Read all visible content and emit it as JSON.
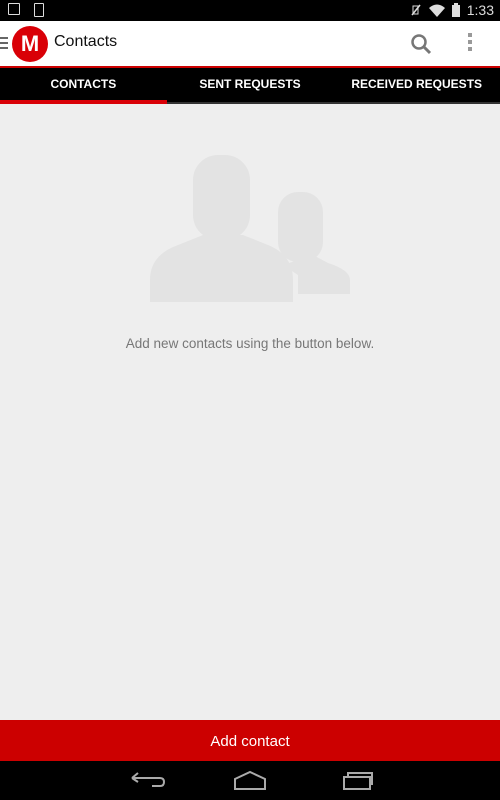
{
  "status_bar": {
    "time": "1:33",
    "left_icons": [
      "image-notification-icon",
      "alert-notification-icon"
    ],
    "right_icons": [
      "vibrate-off-icon",
      "wifi-icon",
      "battery-icon"
    ]
  },
  "app_bar": {
    "logo_letter": "M",
    "title": "Contacts",
    "brand_color": "#d90007"
  },
  "tabs": [
    {
      "label": "CONTACTS",
      "active": true
    },
    {
      "label": "SENT REQUESTS",
      "active": false
    },
    {
      "label": "RECEIVED REQUESTS",
      "active": false
    }
  ],
  "empty_state": {
    "message": "Add new contacts using the button below."
  },
  "add_contact_label": "Add contact"
}
